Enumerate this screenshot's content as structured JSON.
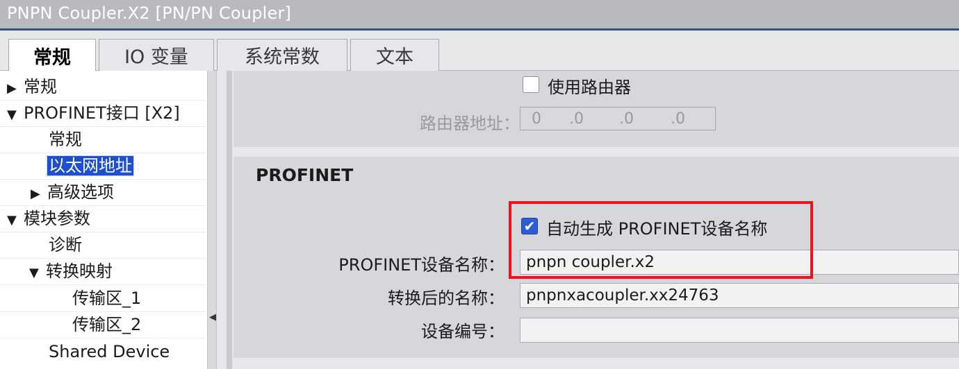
{
  "window": {
    "title": "PNPN Coupler.X2 [PN/PN Coupler]"
  },
  "tabs": [
    {
      "label": "常规",
      "active": true
    },
    {
      "label": "IO 变量",
      "active": false
    },
    {
      "label": "系统常数",
      "active": false
    },
    {
      "label": "文本",
      "active": false
    }
  ],
  "tree": [
    {
      "label": "常规",
      "expander": "collapsed"
    },
    {
      "label": "PROFINET接口 [X2]",
      "expander": "expanded"
    },
    {
      "label": "常规",
      "expander": "none"
    },
    {
      "label": "以太网地址",
      "expander": "none",
      "selected": true
    },
    {
      "label": "高级选项",
      "expander": "collapsed"
    },
    {
      "label": "模块参数",
      "expander": "expanded"
    },
    {
      "label": "诊断",
      "expander": "none"
    },
    {
      "label": "转换映射",
      "expander": "expanded"
    },
    {
      "label": "传输区_1",
      "expander": "none"
    },
    {
      "label": "传输区_2",
      "expander": "none"
    },
    {
      "label": "Shared Device",
      "expander": "none"
    }
  ],
  "router": {
    "use_router_label": "使用路由器",
    "use_router_checked": false,
    "address_label": "路由器地址：",
    "octets": [
      "0",
      ".0",
      ".0",
      ".0"
    ]
  },
  "profinet": {
    "section_title": "PROFINET",
    "auto_name_label": "自动生成 PROFINET设备名称",
    "auto_name_checked": true,
    "device_name_label": "PROFINET设备名称：",
    "device_name_value": "pnpn coupler.x2",
    "converted_name_label": "转换后的名称：",
    "converted_name_value": "pnpnxacoupler.xx24763",
    "device_number_label": "设备编号：",
    "device_number_value": ""
  },
  "icons": {
    "collapsed": "▶",
    "expanded": "▼",
    "checkmark": "✔",
    "splitter": "◀"
  },
  "colors": {
    "selection": "#1f4fd1",
    "highlight_border": "#e8151c",
    "checkbox_checked": "#2a5dd6",
    "title_underline": "#3a4f74"
  }
}
